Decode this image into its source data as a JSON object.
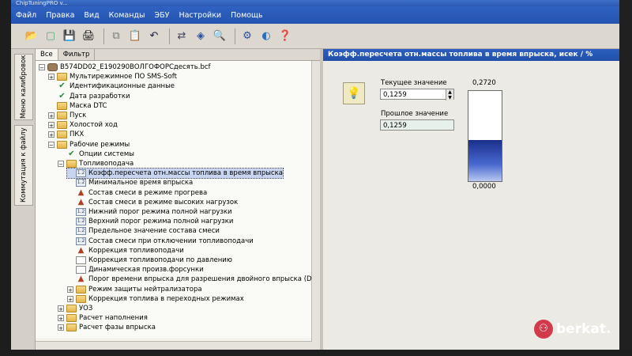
{
  "window": {
    "title": "ChipTuningPRO v..."
  },
  "menu": [
    "Файл",
    "Правка",
    "Вид",
    "Команды",
    "ЭБУ",
    "Настройки",
    "Помощь"
  ],
  "toolbar": {
    "buttons": [
      "open-icon",
      "new-icon",
      "save-icon",
      "print-icon",
      "copy-icon",
      "paste-icon",
      "undo-icon",
      "connect-icon",
      "info-icon",
      "search-icon",
      "settings-icon",
      "tool-icon",
      "help-icon"
    ]
  },
  "vertical_tabs": [
    "Меню калибровок",
    "Коммутация к файлу"
  ],
  "left_tabs": [
    "Все",
    "Фильтр"
  ],
  "tree": [
    {
      "level": 0,
      "label": "B574DD02_E190290ВОЛГОФОРСдесять.bcf",
      "icon": "car",
      "expander": "-"
    },
    {
      "level": 1,
      "label": "Мультирежимное ПО SMS-Soft",
      "icon": "folder",
      "expander": "+"
    },
    {
      "level": 1,
      "label": "Идентификационные данные",
      "icon": "check",
      "expander": ""
    },
    {
      "level": 1,
      "label": "Дата разработки",
      "icon": "check",
      "expander": ""
    },
    {
      "level": 1,
      "label": "Маска DTC",
      "icon": "folder",
      "expander": ""
    },
    {
      "level": 1,
      "label": "Пуск",
      "icon": "folder",
      "expander": "+"
    },
    {
      "level": 1,
      "label": "Холостой ход",
      "icon": "folder",
      "expander": "+"
    },
    {
      "level": 1,
      "label": "ПКХ",
      "icon": "folder",
      "expander": "+"
    },
    {
      "level": 1,
      "label": "Рабочие режимы",
      "icon": "folder",
      "expander": "-"
    },
    {
      "level": 2,
      "label": "Опции системы",
      "icon": "check",
      "expander": ""
    },
    {
      "level": 2,
      "label": "Топливоподача",
      "icon": "folder",
      "expander": "-"
    },
    {
      "level": 3,
      "label": "Коэфф.пересчета отн.массы топлива в время впрыска",
      "icon": "table",
      "expander": "",
      "selected": true
    },
    {
      "level": 3,
      "label": "Минимальное время впрыска",
      "icon": "table",
      "expander": ""
    },
    {
      "level": 3,
      "label": "Состав смеси в режиме прогрева",
      "icon": "chart",
      "expander": ""
    },
    {
      "level": 3,
      "label": "Состав смеси в режиме высоких нагрузок",
      "icon": "chart",
      "expander": ""
    },
    {
      "level": 3,
      "label": "Нижний порог режима полной нагрузки",
      "icon": "table",
      "expander": ""
    },
    {
      "level": 3,
      "label": "Верхний порог режима полной нагрузки",
      "icon": "table",
      "expander": ""
    },
    {
      "level": 3,
      "label": "Предельное значение состава смеси",
      "icon": "table",
      "expander": ""
    },
    {
      "level": 3,
      "label": "Состав смеси при отключении топливоподачи",
      "icon": "table",
      "expander": ""
    },
    {
      "level": 3,
      "label": "Коррекция топливоподачи",
      "icon": "chart",
      "expander": ""
    },
    {
      "level": 3,
      "label": "Коррекция топливоподачи по давлению",
      "icon": "doc",
      "expander": ""
    },
    {
      "level": 3,
      "label": "Динамическая произв.форсунки",
      "icon": "doc",
      "expander": ""
    },
    {
      "level": 3,
      "label": "Порог времени впрыска для разрешения двойного впрыска (DGFI)",
      "icon": "chart",
      "expander": ""
    },
    {
      "level": 3,
      "label": "Режим защиты нейтрализатора",
      "icon": "folder",
      "expander": "+"
    },
    {
      "level": 3,
      "label": "Коррекция топлива в переходных режимах",
      "icon": "folder",
      "expander": "+"
    },
    {
      "level": 2,
      "label": "УОЗ",
      "icon": "folder",
      "expander": "+"
    },
    {
      "level": 2,
      "label": "Расчет наполнения",
      "icon": "folder",
      "expander": "+"
    },
    {
      "level": 2,
      "label": "Расчет фазы впрыска",
      "icon": "folder",
      "expander": "+"
    }
  ],
  "param": {
    "header": "Коэфф.пересчета отн.массы топлива в время впрыска, исек / %",
    "current_label": "Текущее значение",
    "current_value": "0,1259",
    "previous_label": "Прошлое значение",
    "previous_value": "0,1259",
    "gauge_max": "0,2720",
    "gauge_min": "0,0000",
    "gauge_level": 0.46
  },
  "watermark": "berkat."
}
